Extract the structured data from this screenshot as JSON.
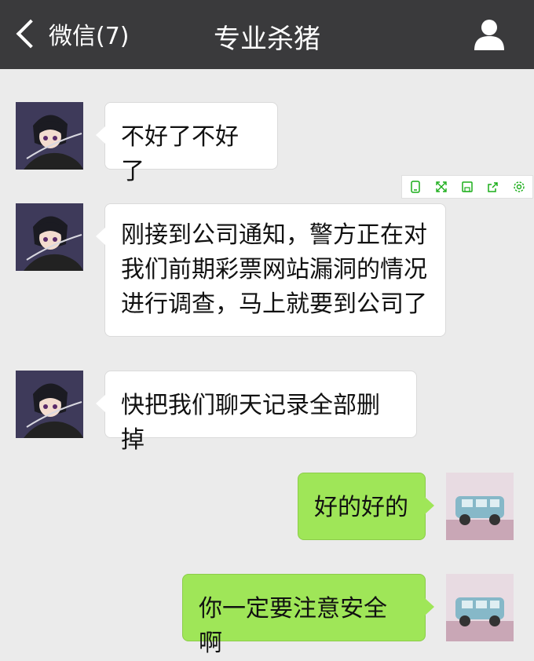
{
  "header": {
    "back_label": "微信(7)",
    "title": "专业杀猪"
  },
  "messages": [
    {
      "side": "in",
      "text": "不好了不好了"
    },
    {
      "side": "in",
      "text": "刚接到公司通知，警方正在对我们前期彩票网站漏洞的情况进行调查，马上就要到公司了"
    },
    {
      "side": "in",
      "text": "快把我们聊天记录全部删掉"
    },
    {
      "side": "out",
      "text": "好的好的"
    },
    {
      "side": "out",
      "text": "你一定要注意安全啊"
    }
  ],
  "toolbar": {
    "icons": [
      "phone-icon",
      "expand-icon",
      "save-icon",
      "share-icon",
      "settings-icon"
    ],
    "color": "#1aad19"
  },
  "colors": {
    "header_bg": "#3a3a3c",
    "page_bg": "#ebebeb",
    "incoming_bubble": "#ffffff",
    "outgoing_bubble": "#9fe658"
  }
}
